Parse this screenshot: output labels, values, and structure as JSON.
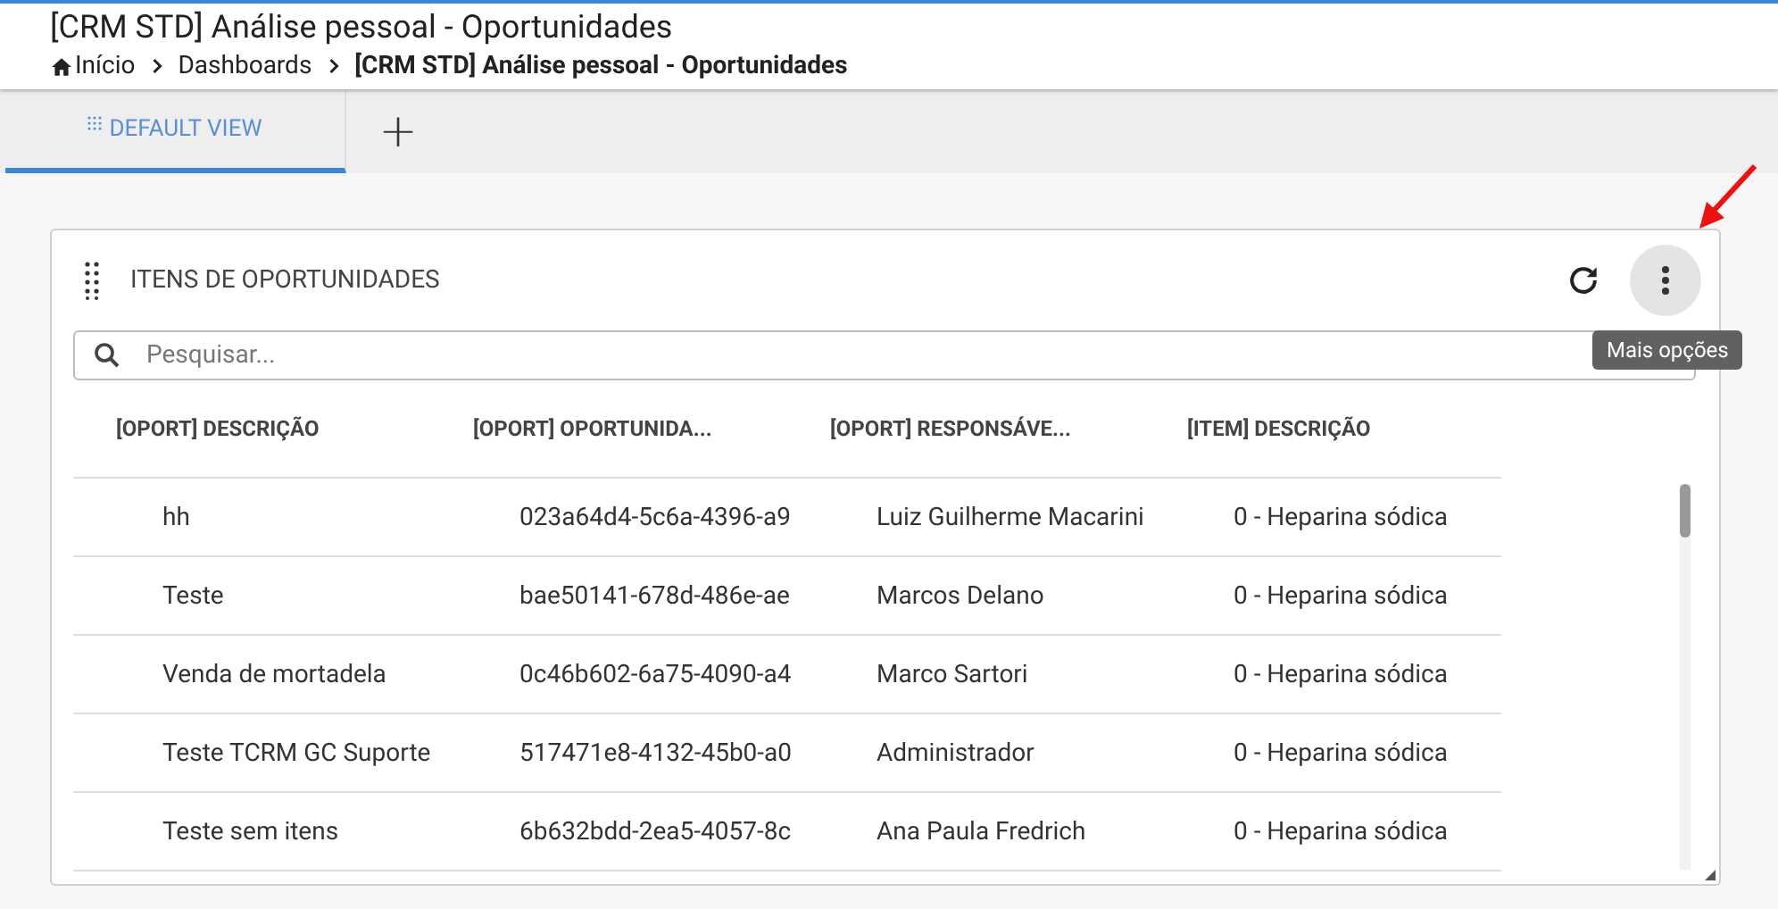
{
  "header": {
    "title": "[CRM STD] Análise pessoal - Oportunidades",
    "breadcrumb": [
      {
        "label": "Início",
        "kind": "home"
      },
      {
        "label": "Dashboards",
        "kind": "link"
      },
      {
        "label": "[CRM STD] Análise pessoal - Oportunidades",
        "kind": "current"
      }
    ]
  },
  "tabs": [
    {
      "label": "DEFAULT VIEW",
      "selected": true
    }
  ],
  "add_tab": "+",
  "widget": {
    "title": "ITENS DE OPORTUNIDADES",
    "tooltip": "Mais opções",
    "search": {
      "placeholder": "Pesquisar..."
    },
    "table": {
      "columns": [
        "[OPORT] DESCRIÇÃO",
        "[OPORT] OPORTUNIDA...",
        "[OPORT] RESPONSÁVE...",
        "[ITEM] DESCRIÇÃO"
      ],
      "rows": [
        [
          "hh",
          "023a64d4-5c6a-4396-a9",
          "Luiz Guilherme Macarini",
          "0 - Heparina sódica"
        ],
        [
          "Teste",
          "bae50141-678d-486e-ae",
          "Marcos Delano",
          "0 - Heparina sódica"
        ],
        [
          "Venda de mortadela",
          "0c46b602-6a75-4090-a4",
          "Marco Sartori",
          "0 - Heparina sódica"
        ],
        [
          "Teste TCRM GC Suporte",
          "517471e8-4132-45b0-a0",
          "Administrador",
          "0 - Heparina sódica"
        ],
        [
          "Teste sem itens",
          "6b632bdd-2ea5-4057-8c",
          "Ana Paula Fredrich",
          "0 - Heparina sódica"
        ]
      ]
    }
  }
}
